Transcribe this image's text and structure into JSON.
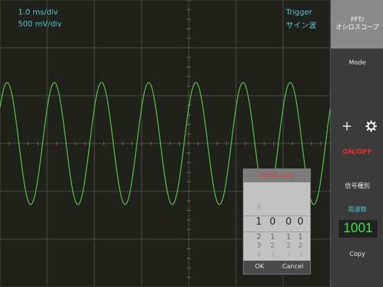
{
  "readouts": {
    "time_div": "1.0 ms/div",
    "volt_div": "500 mV/div",
    "trigger": "Trigger",
    "signal": "サイン波"
  },
  "sidebar": {
    "fft_label_1": "FFT/",
    "fft_label_2": "オシロスコープ",
    "mode": "Mode",
    "onoff": "ON/OFF",
    "signal_type": "信号種別",
    "frequency_label": "周波数",
    "frequency_value": "1001",
    "copy": "Copy"
  },
  "picker": {
    "title": "ENTER FREQ",
    "columns": [
      {
        "above": [
          "",
          "0"
        ],
        "selected": "1",
        "below": [
          "2",
          "3",
          "4"
        ]
      },
      {
        "above": [
          "",
          ""
        ],
        "selected": "0",
        "below": [
          "1",
          "2",
          "3"
        ]
      },
      {
        "above": [
          "",
          ""
        ],
        "selected": "0",
        "below": [
          "1",
          "2",
          "3"
        ]
      },
      {
        "above": [
          "",
          ""
        ],
        "selected": "0",
        "below": [
          "1",
          "2",
          "3"
        ]
      }
    ],
    "ok": "OK",
    "cancel": "Cancel"
  },
  "colors": {
    "trace": "#5fbf4a",
    "grid": "#4a4a3c",
    "readout": "#56c4d6",
    "alert": "#e03030",
    "freq_value": "#40e040"
  },
  "icons": [
    "cursor-plus-icon",
    "gear-icon"
  ]
}
